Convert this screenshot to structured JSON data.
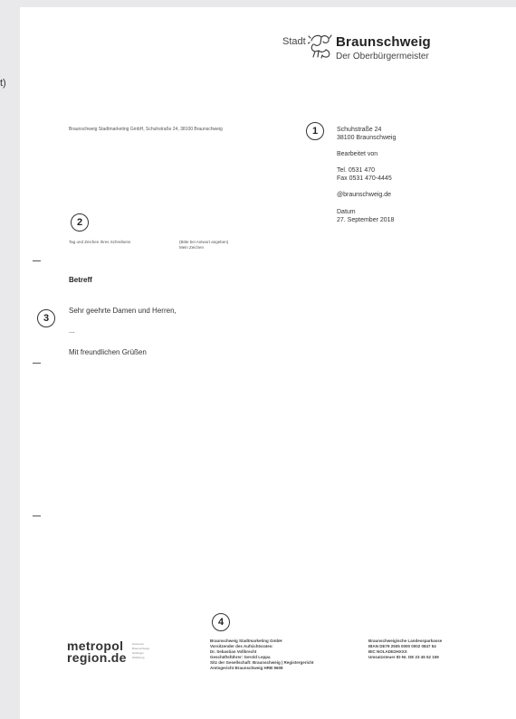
{
  "cutoff_text": "t)",
  "logo": {
    "stadt": "Stadt",
    "city": "Braunschweig",
    "subtitle": "Der Oberbürgermeister"
  },
  "sender_line": "Braunschweig Stadtmarketing GmbH, Schuhstraße 24, 38100 Braunschweig",
  "badges": [
    "1",
    "2",
    "3",
    "4"
  ],
  "info_block": {
    "street": "Schuhstraße 24",
    "city": "38100 Braunschweig",
    "processed_by": "Bearbeitet von",
    "tel": "Tel. 0531 470",
    "fax": "Fax 0531 470-4445",
    "email": "@braunschweig.de",
    "date_label": "Datum",
    "date_value": "27. September 2018"
  },
  "reference": {
    "your_ref": "Tag und Zeichen Ihres Schreibens",
    "reply_note": "(Bitte bei Antwort angeben)",
    "my_ref": "Mein Zeichen"
  },
  "letter": {
    "subject": "Betreff",
    "salutation": "Sehr geehrte Damen und Herren,",
    "ellipsis": "...",
    "closing": "Mit freundlichen Grüßen"
  },
  "metro_logo": {
    "line1": "metropol",
    "line2": "region.de",
    "side": [
      "Hannover",
      "Braunschweig",
      "Göttingen",
      "Wolfsburg"
    ]
  },
  "footer_company": [
    "Braunschweig Stadtmarketing GmbH",
    "Vorsitzender des Aufsichtsrates:",
    "Dr. Sebastian Vollbrecht",
    "Geschäftsführer: Gerold Leppa",
    "Sitz der Gesellschaft: Braunschweig | Registergericht",
    "Amtsgericht Braunschweig HRB 9608"
  ],
  "footer_bank": [
    "Braunschweigische Landessparkasse",
    "IBAN DE79 2505 0000 0002 0847 54",
    "BIC NOLADE2HXXX",
    "Umsatzsteuer ID-Nr. DE 23 45 52 159"
  ]
}
